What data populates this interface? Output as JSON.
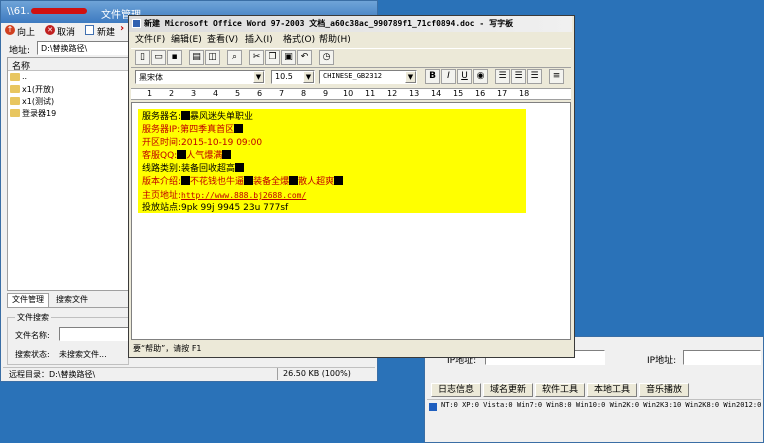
{
  "file_manager": {
    "title_prefix": "\\\\61.",
    "title": "文件管理",
    "toolbar": {
      "up": "向上",
      "cancel": "取消",
      "new": "新建"
    },
    "address_label": "地址:",
    "address_value": "D:\\替换路径\\",
    "list_header": "名称",
    "items": [
      {
        "label": ".."
      },
      {
        "label": "x1(开放)"
      },
      {
        "label": "x1(测试)"
      },
      {
        "label": "登录器19"
      }
    ],
    "tabs": {
      "file_mgmt": "文件管理",
      "search": "搜索文件"
    },
    "search_group": "文件搜索",
    "filename_label": "文件名称:",
    "status_label": "搜索状态:",
    "status_value": "未搜索文件...",
    "statusbar_path": "远程目录：D:\\替换路径\\",
    "statusbar_size": "26.50 KB (100%)"
  },
  "wordpad": {
    "title": "新建 Microsoft Office Word 97-2003 文档_a60c38ac_990789f1_71cf0894.doc - 写字板",
    "menu": [
      "文件(F)",
      "编辑(E)",
      "查看(V)",
      "插入(I)",
      "格式(O)",
      "帮助(H)"
    ],
    "font_name": "黑宋体",
    "font_size": "10.5",
    "charset": "CHINESE_GB2312",
    "format_buttons": {
      "bold": "B",
      "italic": "I",
      "underline": "U"
    },
    "ruler": [
      "1",
      "2",
      "3",
      "4",
      "5",
      "6",
      "7",
      "8",
      "9",
      "10",
      "11",
      "12",
      "13",
      "14",
      "15",
      "16",
      "17",
      "18"
    ],
    "doc": {
      "l1_label": "服务器名:",
      "l1_text": "暴风迷失单职业",
      "l2_label": "服务器IP:",
      "l2_text": "第四季真首区",
      "l3": "开区时间:2015-10-19 09:00",
      "l4_label": "客服QQ:",
      "l4_text": "人气爆满",
      "l5_text": "线路类别:装备回收超高",
      "l6_label": "版本介绍:",
      "l6_a": "不花钱也牛逼",
      "l6_b": "装备全爆",
      "l6_c": "散人超爽",
      "l7_label": "主页地址:",
      "l7_url": "http://www.888.bj2688.com/",
      "l8": "投放站点:9pk 99j 9945 23u  777sf"
    },
    "status": "要“帮助”，请按 F1"
  },
  "background_window": {
    "field_label": "IP地址:",
    "tabs": [
      "日志信息",
      "域名更新",
      "软件工具",
      "本地工具",
      "音乐播放"
    ],
    "os_stats": "NT:0 XP:0 Vista:0 Win7:0 Win8:0 Win10:0 Win2K:0 Win2K3:10 Win2K8:0 Win2012:0"
  }
}
